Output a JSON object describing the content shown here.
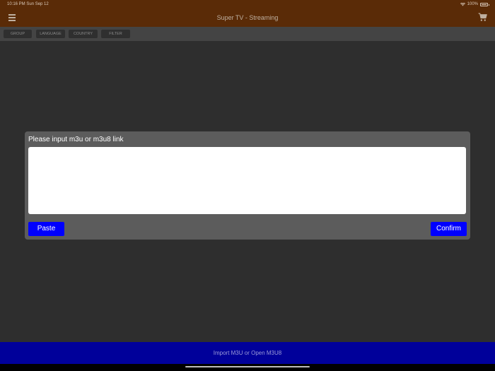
{
  "status_bar": {
    "time_date": "10:16 PM   Sun Sep 12",
    "battery": "100%",
    "wifi_icon": "wifi-icon",
    "battery_icon": "battery-icon"
  },
  "nav_bar": {
    "title": "Super TV - Streaming",
    "menu_icon": "hamburger-menu-icon",
    "cart_icon": "shopping-cart-icon",
    "background_color": "#5a2b07"
  },
  "filters": [
    {
      "label": "GROUP"
    },
    {
      "label": "LANGUAGE"
    },
    {
      "label": "COUNTRY"
    },
    {
      "label": "FILTER"
    }
  ],
  "dialog": {
    "title": "Please input m3u or m3u8 link",
    "input_value": "",
    "paste_label": "Paste",
    "confirm_label": "Confirm",
    "button_color": "#0000ff"
  },
  "bottom_bar": {
    "label": "Import M3U or Open M3U8",
    "background_color": "#00009a"
  }
}
